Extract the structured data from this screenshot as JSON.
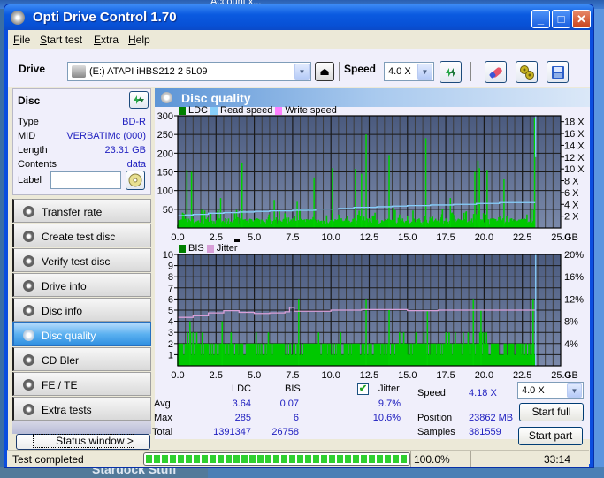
{
  "desktop": {
    "top_label": "Account x...",
    "bottom_label": "Stardock Stuff"
  },
  "window": {
    "title": "Opti Drive Control 1.70",
    "buttons": {
      "minimize": "_",
      "maximize": "□",
      "close": "✕"
    }
  },
  "menu": [
    {
      "label": "File",
      "u": "F",
      "rest": "ile"
    },
    {
      "label": "Start test",
      "u": "S",
      "rest": "tart test"
    },
    {
      "label": "Extra",
      "u": "E",
      "rest": "xtra"
    },
    {
      "label": "Help",
      "u": "H",
      "rest": "elp"
    }
  ],
  "toolbar": {
    "drive_label": "Drive",
    "drive_value": "(E:)  ATAPI iHBS212   2 5L09",
    "speed_label": "Speed",
    "speed_value": "4.0 X",
    "icons": [
      "refresh-icon",
      "eraser-icon",
      "settings-icon",
      "save-icon"
    ]
  },
  "disc": {
    "title": "Disc",
    "rows": [
      {
        "key": "Type",
        "value": "BD-R"
      },
      {
        "key": "MID",
        "value": "VERBATIMc (000)"
      },
      {
        "key": "Length",
        "value": "23.31 GB"
      },
      {
        "key": "Contents",
        "value": "data"
      }
    ],
    "label_key": "Label",
    "label_value": ""
  },
  "nav": [
    {
      "label": "Transfer rate",
      "active": false
    },
    {
      "label": "Create test disc",
      "active": false
    },
    {
      "label": "Verify test disc",
      "active": false
    },
    {
      "label": "Drive info",
      "active": false
    },
    {
      "label": "Disc info",
      "active": false
    },
    {
      "label": "Disc quality",
      "active": true
    },
    {
      "label": "CD Bler",
      "active": false
    },
    {
      "label": "FE / TE",
      "active": false
    },
    {
      "label": "Extra tests",
      "active": false
    }
  ],
  "status_window_button": "Status window > >",
  "panel": {
    "title": "Disc quality"
  },
  "chart_data": [
    {
      "type": "bar",
      "title": "LDC",
      "legend": [
        {
          "name": "LDC",
          "color": "#008000"
        },
        {
          "name": "Read speed",
          "color": "#87cefa"
        },
        {
          "name": "Write speed",
          "color": "#ff80ff"
        }
      ],
      "xlabel": "GB",
      "x_ticks": [
        "0.0",
        "2.5",
        "5.0",
        "7.5",
        "10.0",
        "12.5",
        "15.0",
        "17.5",
        "20.0",
        "22.5",
        "25.0"
      ],
      "xlim": [
        0,
        25
      ],
      "y_ticks": [
        "50",
        "100",
        "150",
        "200",
        "250",
        "300"
      ],
      "ylim": [
        0,
        300
      ],
      "y2_ticks": [
        "2 X",
        "4 X",
        "6 X",
        "8 X",
        "10 X",
        "12 X",
        "14 X",
        "16 X",
        "18 X"
      ],
      "y2lim": [
        0,
        19
      ],
      "grid": true,
      "data_end_gb": 23.31,
      "ldc_spikes": [
        [
          0.6,
          155
        ],
        [
          0.9,
          150
        ],
        [
          2.8,
          80
        ],
        [
          4.2,
          175
        ],
        [
          6.3,
          75
        ],
        [
          7.8,
          70
        ],
        [
          8.9,
          135
        ],
        [
          10.1,
          160
        ],
        [
          11.6,
          158
        ],
        [
          12.0,
          145
        ],
        [
          12.3,
          250
        ],
        [
          13.8,
          195
        ],
        [
          16.2,
          240
        ],
        [
          17.8,
          80
        ],
        [
          19.4,
          150
        ],
        [
          19.6,
          180
        ],
        [
          19.7,
          160
        ],
        [
          20.2,
          155
        ],
        [
          21.3,
          130
        ],
        [
          23.3,
          295
        ]
      ],
      "read_speed": [
        [
          0,
          2.1
        ],
        [
          0.5,
          2.2
        ],
        [
          1.0,
          2.3
        ],
        [
          2.0,
          2.5
        ],
        [
          3.0,
          2.6
        ],
        [
          4.0,
          2.7
        ],
        [
          5.0,
          2.8
        ],
        [
          6.0,
          2.9
        ],
        [
          7.5,
          3.0
        ],
        [
          9.0,
          3.2
        ],
        [
          10.5,
          3.3
        ],
        [
          11.5,
          3.5
        ],
        [
          13.0,
          3.6
        ],
        [
          14.0,
          3.7
        ],
        [
          15.0,
          3.8
        ],
        [
          16.5,
          3.9
        ],
        [
          18.0,
          4.0
        ],
        [
          19.5,
          4.15
        ],
        [
          21.0,
          4.3
        ],
        [
          23.3,
          4.4
        ]
      ]
    },
    {
      "type": "bar",
      "title": "BIS",
      "legend": [
        {
          "name": "BIS",
          "color": "#008000"
        },
        {
          "name": "Jitter",
          "color": "#d8a0d8"
        }
      ],
      "xlabel": "GB",
      "x_ticks": [
        "0.0",
        "2.5",
        "5.0",
        "7.5",
        "10.0",
        "12.5",
        "15.0",
        "17.5",
        "20.0",
        "22.5",
        "25.0"
      ],
      "xlim": [
        0,
        25
      ],
      "y_ticks": [
        "1",
        "2",
        "3",
        "4",
        "5",
        "6",
        "7",
        "8",
        "9",
        "10"
      ],
      "ylim": [
        0,
        10
      ],
      "y2_ticks": [
        "4%",
        "8%",
        "12%",
        "16%",
        "20%"
      ],
      "y2lim": [
        0,
        20
      ],
      "grid": true,
      "data_end_gb": 23.31,
      "bis_spikes": [
        [
          0.8,
          4
        ],
        [
          2.9,
          4
        ],
        [
          7.9,
          6
        ],
        [
          12.3,
          6
        ],
        [
          13.8,
          5
        ],
        [
          16.3,
          5
        ],
        [
          19.3,
          6
        ],
        [
          19.8,
          5
        ],
        [
          23.2,
          6
        ]
      ],
      "jitter": [
        [
          0,
          8.7
        ],
        [
          1,
          9.0
        ],
        [
          2,
          9.5
        ],
        [
          3,
          9.9
        ],
        [
          4,
          9.6
        ],
        [
          5,
          9.4
        ],
        [
          6,
          9.5
        ],
        [
          7,
          9.7
        ],
        [
          7.3,
          10.5
        ],
        [
          7.6,
          9.8
        ],
        [
          8,
          9.8
        ],
        [
          10,
          10.0
        ],
        [
          12,
          10.1
        ],
        [
          14,
          10.1
        ],
        [
          15,
          9.9
        ],
        [
          17,
          10.0
        ],
        [
          19,
          10.0
        ],
        [
          21,
          10.0
        ],
        [
          23.3,
          9.9
        ]
      ]
    }
  ],
  "stats": {
    "col_ldc": "LDC",
    "col_bis": "BIS",
    "jitter_label": "Jitter",
    "jitter_checked": true,
    "rows": [
      {
        "label": "Avg",
        "ldc": "3.64",
        "bis": "0.07",
        "jitter": "9.7%"
      },
      {
        "label": "Max",
        "ldc": "285",
        "bis": "6",
        "jitter": "10.6%"
      },
      {
        "label": "Total",
        "ldc": "1391347",
        "bis": "26758",
        "jitter": ""
      }
    ],
    "speed_label": "Speed",
    "speed_value": "4.18 X",
    "position_label": "Position",
    "position_value": "23862 MB",
    "samples_label": "Samples",
    "samples_value": "381559",
    "speed_select": "4.0 X",
    "start_full": "Start full",
    "start_part": "Start part"
  },
  "statusbar": {
    "text": "Test completed",
    "progress": 1.0,
    "percent": "100.0%",
    "time": "33:14"
  }
}
